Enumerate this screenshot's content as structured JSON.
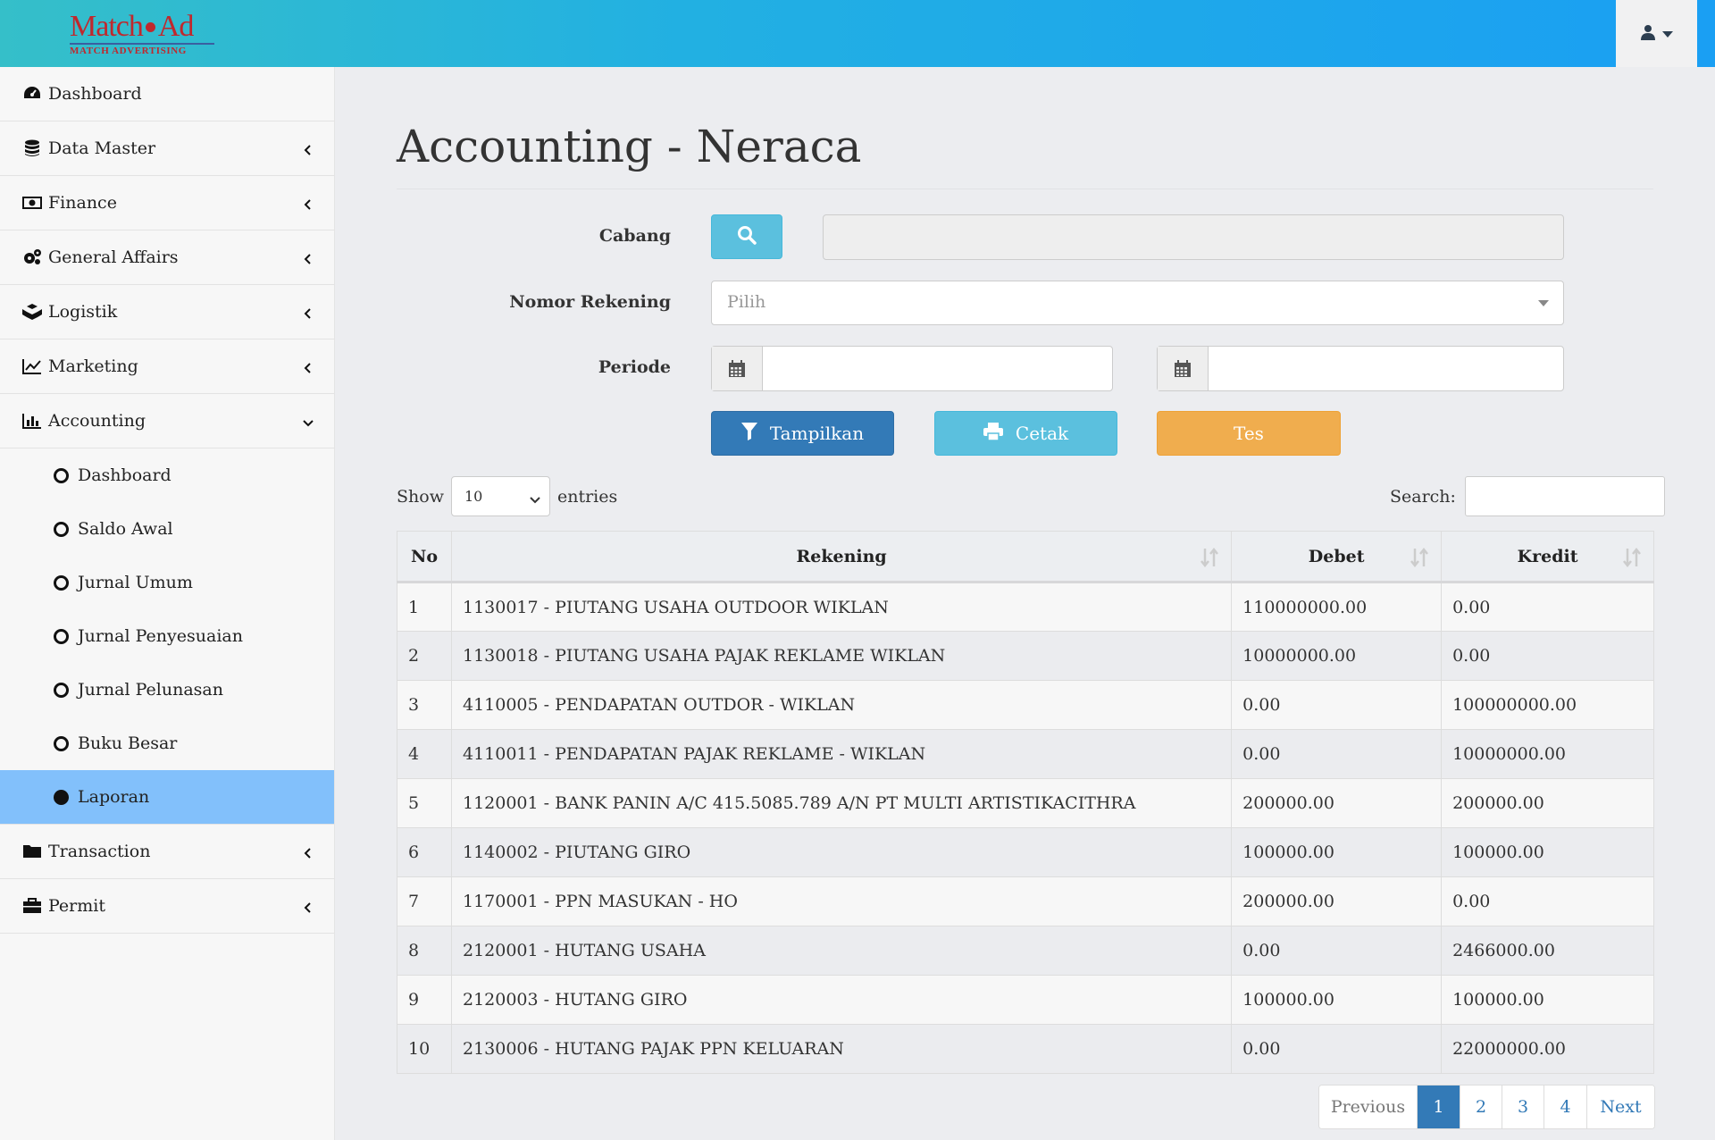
{
  "header": {
    "logo_brand_left": "Match",
    "logo_brand_right": "Ad",
    "logo_tagline": "MATCH ADVERTISING"
  },
  "sidebar": {
    "items": [
      {
        "label": "Dashboard",
        "icon": "dashboard-icon"
      },
      {
        "label": "Data Master",
        "icon": "database-icon"
      },
      {
        "label": "Finance",
        "icon": "money-icon"
      },
      {
        "label": "General Affairs",
        "icon": "cogs-icon"
      },
      {
        "label": "Logistik",
        "icon": "cubes-icon"
      },
      {
        "label": "Marketing",
        "icon": "line-chart-icon"
      },
      {
        "label": "Accounting",
        "icon": "bar-chart-icon"
      },
      {
        "label": "Transaction",
        "icon": "folder-icon"
      },
      {
        "label": "Permit",
        "icon": "briefcase-icon"
      }
    ],
    "accounting_sub": [
      {
        "label": "Dashboard"
      },
      {
        "label": "Saldo Awal"
      },
      {
        "label": "Jurnal Umum"
      },
      {
        "label": "Jurnal Penyesuaian"
      },
      {
        "label": "Jurnal Pelunasan"
      },
      {
        "label": "Buku Besar"
      },
      {
        "label": "Laporan"
      }
    ]
  },
  "main": {
    "title": "Accounting - Neraca",
    "form": {
      "cabang_label": "Cabang",
      "cabang_value": "",
      "rekening_label": "Nomor Rekening",
      "rekening_placeholder": "Pilih",
      "periode_label": "Periode",
      "periode_start": "",
      "periode_end": ""
    },
    "buttons": {
      "tampilkan": "Tampilkan",
      "cetak": "Cetak",
      "tes": "Tes"
    },
    "table_controls": {
      "show_label": "Show",
      "page_length": "10",
      "entries_label": "entries",
      "search_label": "Search:",
      "search_value": ""
    },
    "table": {
      "headers": [
        "No",
        "Rekening",
        "Debet",
        "Kredit"
      ],
      "rows": [
        [
          "1",
          "1130017 - PIUTANG USAHA OUTDOOR WIKLAN",
          "110000000.00",
          "0.00"
        ],
        [
          "2",
          "1130018 - PIUTANG USAHA PAJAK REKLAME WIKLAN",
          "10000000.00",
          "0.00"
        ],
        [
          "3",
          "4110005 - PENDAPATAN OUTDOR - WIKLAN",
          "0.00",
          "100000000.00"
        ],
        [
          "4",
          "4110011 - PENDAPATAN PAJAK REKLAME - WIKLAN",
          "0.00",
          "10000000.00"
        ],
        [
          "5",
          "1120001 - BANK PANIN A/C 415.5085.789 A/N PT MULTI ARTISTIKACITHRA",
          "200000.00",
          "200000.00"
        ],
        [
          "6",
          "1140002 - PIUTANG GIRO",
          "100000.00",
          "100000.00"
        ],
        [
          "7",
          "1170001 - PPN MASUKAN - HO",
          "200000.00",
          "0.00"
        ],
        [
          "8",
          "2120001 - HUTANG USAHA",
          "0.00",
          "2466000.00"
        ],
        [
          "9",
          "2120003 - HUTANG GIRO",
          "100000.00",
          "100000.00"
        ],
        [
          "10",
          "2130006 - HUTANG PAJAK PPN KELUARAN",
          "0.00",
          "22000000.00"
        ]
      ]
    },
    "pagination": {
      "previous": "Previous",
      "pages": [
        "1",
        "2",
        "3",
        "4"
      ],
      "current": "1",
      "next": "Next"
    }
  },
  "colors": {
    "header_gradient_start": "#35bfc9",
    "header_gradient_end": "#1a9ff3",
    "active_nav": "#82c0fb",
    "primary": "#337ab7",
    "info": "#5bc0de",
    "warning": "#f0ad4e",
    "brand_red": "#c0282d"
  }
}
